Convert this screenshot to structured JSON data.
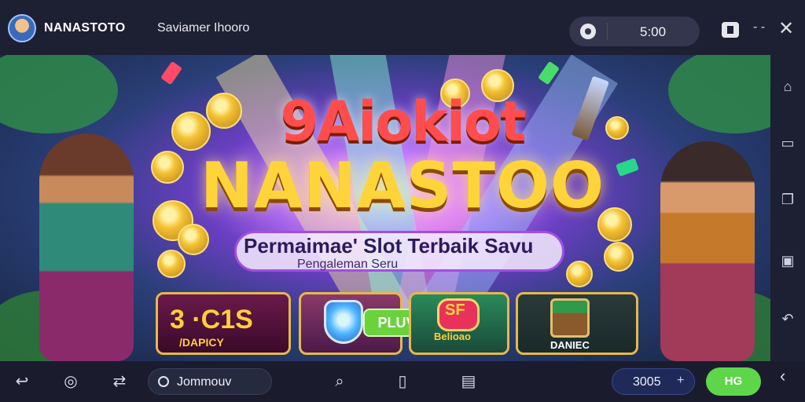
{
  "header": {
    "brand": "NANASTOTO",
    "subtitle": "Saviamer Ihooro",
    "timer": "5:00",
    "icons": [
      "avatar",
      "timer-icon",
      "box-icon",
      "minus-icon",
      "close-icon"
    ]
  },
  "banner": {
    "title_top": "9Aiokiot",
    "title_main": "NANASTOO",
    "tagline": "Permaimae' Slot Terbaik Savu",
    "tagline_sub": "Pengaleman Seru",
    "tiles": [
      {
        "big": "3 ·C1S",
        "small": "/DAPICY"
      },
      {
        "button": "PLUVR"
      },
      {
        "big": "SF",
        "small": "Belioao"
      },
      {
        "small": "DANIEC"
      }
    ]
  },
  "sidebar": {
    "icons": [
      "home-icon",
      "square-icon",
      "layers-icon",
      "window-icon",
      "back-arrow-icon"
    ]
  },
  "footer": {
    "search_text": "Jommouv",
    "amount": "3005",
    "amount_symbol": "+",
    "go_label": "HG",
    "icons": [
      "back-icon",
      "compass-icon",
      "sync-icon",
      "search-icon",
      "phone-icon",
      "chat-icon",
      "chevron-left-icon"
    ]
  },
  "colors": {
    "top_bar": "#1d1f33",
    "title_gold": "#ffd43a",
    "accent_green": "#5ed64a",
    "tile_border": "#e6b84a"
  }
}
